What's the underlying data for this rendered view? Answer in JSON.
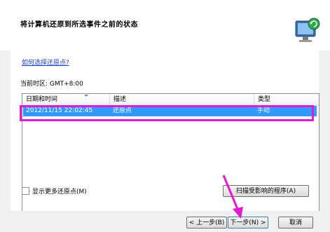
{
  "dialog": {
    "title": "将计算机还原到所选事件之前的状态",
    "help_link": "如何选择还原点?",
    "timezone_label": "当前时区: GMT+8:00",
    "table": {
      "columns": [
        "日期和时间",
        "描述",
        "类型"
      ],
      "rows": [
        {
          "datetime": "2012/11/15 22:02:45",
          "description": "还原点",
          "type": "手动"
        }
      ],
      "selected_row": 0
    },
    "show_more_label": "显示更多还原点(M)",
    "show_more_checked": false,
    "scan_button": "扫描受影响的程序(A)",
    "back_button": "< 上一步(B)",
    "next_button": "下一步(N) >",
    "cancel_button": "取消"
  },
  "colors": {
    "selection": "#3399ff",
    "annotation": "#e21ad0",
    "link": "#1a3fc4"
  },
  "icons": [
    "system-restore-icon",
    "sort-caret-icon",
    "annotation-arrow-icon"
  ]
}
